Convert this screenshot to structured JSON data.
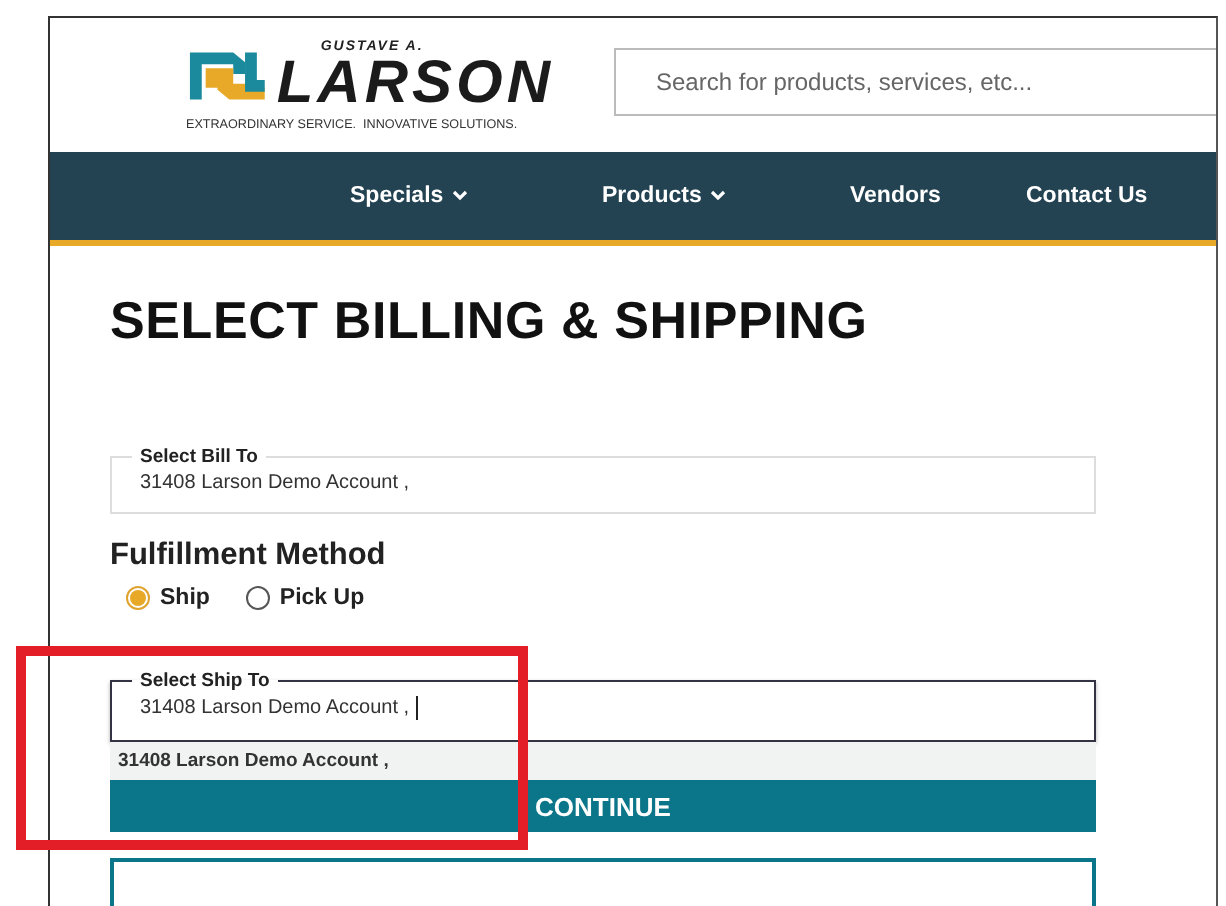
{
  "logo": {
    "overline": "GUSTAVE A.",
    "name": "LARSON",
    "tagline": "EXTRAORDINARY SERVICE.  INNOVATIVE SOLUTIONS."
  },
  "search": {
    "placeholder": "Search for products, services, etc..."
  },
  "nav": [
    {
      "label": "Specials",
      "dropdown": true
    },
    {
      "label": "Products",
      "dropdown": true
    },
    {
      "label": "Vendors",
      "dropdown": false
    },
    {
      "label": "Contact Us",
      "dropdown": false
    }
  ],
  "title": "SELECT BILLING & SHIPPING",
  "bill_to": {
    "label": "Select Bill To",
    "value": "31408 Larson Demo Account ,"
  },
  "fulfillment": {
    "heading": "Fulfillment Method",
    "options": [
      {
        "label": "Ship",
        "selected": true
      },
      {
        "label": "Pick Up",
        "selected": false
      }
    ]
  },
  "ship_to": {
    "label": "Select Ship To",
    "value": "31408 Larson Demo Account ,",
    "suggestions": [
      "31408 Larson Demo Account ,"
    ]
  },
  "continue_button": "CONTINUE"
}
